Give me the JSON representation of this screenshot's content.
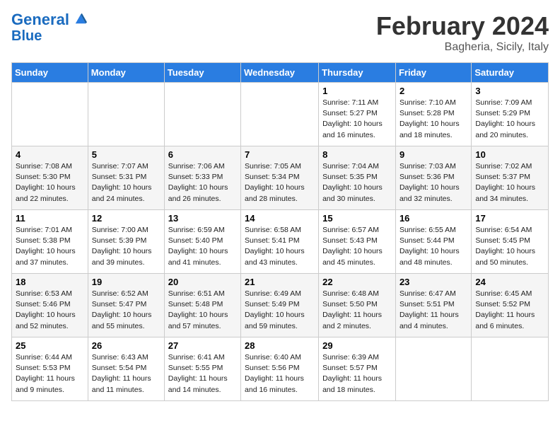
{
  "logo": {
    "line1": "General",
    "line2": "Blue"
  },
  "title": "February 2024",
  "location": "Bagheria, Sicily, Italy",
  "weekdays": [
    "Sunday",
    "Monday",
    "Tuesday",
    "Wednesday",
    "Thursday",
    "Friday",
    "Saturday"
  ],
  "weeks": [
    [
      {
        "day": "",
        "info": ""
      },
      {
        "day": "",
        "info": ""
      },
      {
        "day": "",
        "info": ""
      },
      {
        "day": "",
        "info": ""
      },
      {
        "day": "1",
        "info": "Sunrise: 7:11 AM\nSunset: 5:27 PM\nDaylight: 10 hours\nand 16 minutes."
      },
      {
        "day": "2",
        "info": "Sunrise: 7:10 AM\nSunset: 5:28 PM\nDaylight: 10 hours\nand 18 minutes."
      },
      {
        "day": "3",
        "info": "Sunrise: 7:09 AM\nSunset: 5:29 PM\nDaylight: 10 hours\nand 20 minutes."
      }
    ],
    [
      {
        "day": "4",
        "info": "Sunrise: 7:08 AM\nSunset: 5:30 PM\nDaylight: 10 hours\nand 22 minutes."
      },
      {
        "day": "5",
        "info": "Sunrise: 7:07 AM\nSunset: 5:31 PM\nDaylight: 10 hours\nand 24 minutes."
      },
      {
        "day": "6",
        "info": "Sunrise: 7:06 AM\nSunset: 5:33 PM\nDaylight: 10 hours\nand 26 minutes."
      },
      {
        "day": "7",
        "info": "Sunrise: 7:05 AM\nSunset: 5:34 PM\nDaylight: 10 hours\nand 28 minutes."
      },
      {
        "day": "8",
        "info": "Sunrise: 7:04 AM\nSunset: 5:35 PM\nDaylight: 10 hours\nand 30 minutes."
      },
      {
        "day": "9",
        "info": "Sunrise: 7:03 AM\nSunset: 5:36 PM\nDaylight: 10 hours\nand 32 minutes."
      },
      {
        "day": "10",
        "info": "Sunrise: 7:02 AM\nSunset: 5:37 PM\nDaylight: 10 hours\nand 34 minutes."
      }
    ],
    [
      {
        "day": "11",
        "info": "Sunrise: 7:01 AM\nSunset: 5:38 PM\nDaylight: 10 hours\nand 37 minutes."
      },
      {
        "day": "12",
        "info": "Sunrise: 7:00 AM\nSunset: 5:39 PM\nDaylight: 10 hours\nand 39 minutes."
      },
      {
        "day": "13",
        "info": "Sunrise: 6:59 AM\nSunset: 5:40 PM\nDaylight: 10 hours\nand 41 minutes."
      },
      {
        "day": "14",
        "info": "Sunrise: 6:58 AM\nSunset: 5:41 PM\nDaylight: 10 hours\nand 43 minutes."
      },
      {
        "day": "15",
        "info": "Sunrise: 6:57 AM\nSunset: 5:43 PM\nDaylight: 10 hours\nand 45 minutes."
      },
      {
        "day": "16",
        "info": "Sunrise: 6:55 AM\nSunset: 5:44 PM\nDaylight: 10 hours\nand 48 minutes."
      },
      {
        "day": "17",
        "info": "Sunrise: 6:54 AM\nSunset: 5:45 PM\nDaylight: 10 hours\nand 50 minutes."
      }
    ],
    [
      {
        "day": "18",
        "info": "Sunrise: 6:53 AM\nSunset: 5:46 PM\nDaylight: 10 hours\nand 52 minutes."
      },
      {
        "day": "19",
        "info": "Sunrise: 6:52 AM\nSunset: 5:47 PM\nDaylight: 10 hours\nand 55 minutes."
      },
      {
        "day": "20",
        "info": "Sunrise: 6:51 AM\nSunset: 5:48 PM\nDaylight: 10 hours\nand 57 minutes."
      },
      {
        "day": "21",
        "info": "Sunrise: 6:49 AM\nSunset: 5:49 PM\nDaylight: 10 hours\nand 59 minutes."
      },
      {
        "day": "22",
        "info": "Sunrise: 6:48 AM\nSunset: 5:50 PM\nDaylight: 11 hours\nand 2 minutes."
      },
      {
        "day": "23",
        "info": "Sunrise: 6:47 AM\nSunset: 5:51 PM\nDaylight: 11 hours\nand 4 minutes."
      },
      {
        "day": "24",
        "info": "Sunrise: 6:45 AM\nSunset: 5:52 PM\nDaylight: 11 hours\nand 6 minutes."
      }
    ],
    [
      {
        "day": "25",
        "info": "Sunrise: 6:44 AM\nSunset: 5:53 PM\nDaylight: 11 hours\nand 9 minutes."
      },
      {
        "day": "26",
        "info": "Sunrise: 6:43 AM\nSunset: 5:54 PM\nDaylight: 11 hours\nand 11 minutes."
      },
      {
        "day": "27",
        "info": "Sunrise: 6:41 AM\nSunset: 5:55 PM\nDaylight: 11 hours\nand 14 minutes."
      },
      {
        "day": "28",
        "info": "Sunrise: 6:40 AM\nSunset: 5:56 PM\nDaylight: 11 hours\nand 16 minutes."
      },
      {
        "day": "29",
        "info": "Sunrise: 6:39 AM\nSunset: 5:57 PM\nDaylight: 11 hours\nand 18 minutes."
      },
      {
        "day": "",
        "info": ""
      },
      {
        "day": "",
        "info": ""
      }
    ]
  ]
}
